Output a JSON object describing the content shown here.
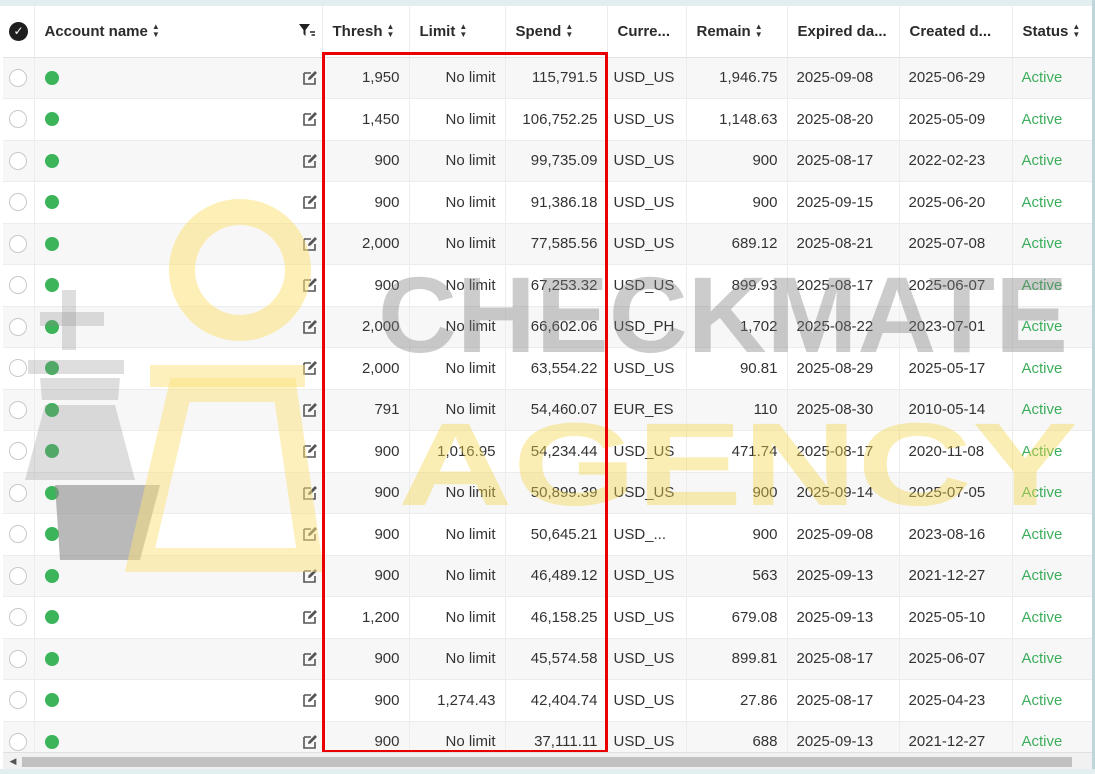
{
  "columns": {
    "account_name": "Account name",
    "thresh": "Thresh",
    "limit": "Limit",
    "spend": "Spend",
    "currency": "Curre...",
    "remain": "Remain",
    "expired": "Expired da...",
    "created": "Created d...",
    "status": "Status"
  },
  "rows": [
    {
      "thresh": "1,950",
      "limit": "No limit",
      "spend": "115,791.5",
      "currency": "USD_US",
      "remain": "1,946.75",
      "expired": "2025-09-08",
      "created": "2025-06-29",
      "status": "Active"
    },
    {
      "thresh": "1,450",
      "limit": "No limit",
      "spend": "106,752.25",
      "currency": "USD_US",
      "remain": "1,148.63",
      "expired": "2025-08-20",
      "created": "2025-05-09",
      "status": "Active"
    },
    {
      "thresh": "900",
      "limit": "No limit",
      "spend": "99,735.09",
      "currency": "USD_US",
      "remain": "900",
      "expired": "2025-08-17",
      "created": "2022-02-23",
      "status": "Active"
    },
    {
      "thresh": "900",
      "limit": "No limit",
      "spend": "91,386.18",
      "currency": "USD_US",
      "remain": "900",
      "expired": "2025-09-15",
      "created": "2025-06-20",
      "status": "Active"
    },
    {
      "thresh": "2,000",
      "limit": "No limit",
      "spend": "77,585.56",
      "currency": "USD_US",
      "remain": "689.12",
      "expired": "2025-08-21",
      "created": "2025-07-08",
      "status": "Active"
    },
    {
      "thresh": "900",
      "limit": "No limit",
      "spend": "67,253.32",
      "currency": "USD_US",
      "remain": "899.93",
      "expired": "2025-08-17",
      "created": "2025-06-07",
      "status": "Active"
    },
    {
      "thresh": "2,000",
      "limit": "No limit",
      "spend": "66,602.06",
      "currency": "USD_PH",
      "remain": "1,702",
      "expired": "2025-08-22",
      "created": "2023-07-01",
      "status": "Active"
    },
    {
      "thresh": "2,000",
      "limit": "No limit",
      "spend": "63,554.22",
      "currency": "USD_US",
      "remain": "90.81",
      "expired": "2025-08-29",
      "created": "2025-05-17",
      "status": "Active"
    },
    {
      "thresh": "791",
      "limit": "No limit",
      "spend": "54,460.07",
      "currency": "EUR_ES",
      "remain": "110",
      "expired": "2025-08-30",
      "created": "2010-05-14",
      "status": "Active"
    },
    {
      "thresh": "900",
      "limit": "1,016.95",
      "spend": "54,234.44",
      "currency": "USD_US",
      "remain": "471.74",
      "expired": "2025-08-17",
      "created": "2020-11-08",
      "status": "Active"
    },
    {
      "thresh": "900",
      "limit": "No limit",
      "spend": "50,899.39",
      "currency": "USD_US",
      "remain": "900",
      "expired": "2025-09-14",
      "created": "2025-07-05",
      "status": "Active"
    },
    {
      "thresh": "900",
      "limit": "No limit",
      "spend": "50,645.21",
      "currency": "USD_...",
      "remain": "900",
      "expired": "2025-09-08",
      "created": "2023-08-16",
      "status": "Active"
    },
    {
      "thresh": "900",
      "limit": "No limit",
      "spend": "46,489.12",
      "currency": "USD_US",
      "remain": "563",
      "expired": "2025-09-13",
      "created": "2021-12-27",
      "status": "Active"
    },
    {
      "thresh": "1,200",
      "limit": "No limit",
      "spend": "46,158.25",
      "currency": "USD_US",
      "remain": "679.08",
      "expired": "2025-09-13",
      "created": "2025-05-10",
      "status": "Active"
    },
    {
      "thresh": "900",
      "limit": "No limit",
      "spend": "45,574.58",
      "currency": "USD_US",
      "remain": "899.81",
      "expired": "2025-08-17",
      "created": "2025-06-07",
      "status": "Active"
    },
    {
      "thresh": "900",
      "limit": "1,274.43",
      "spend": "42,404.74",
      "currency": "USD_US",
      "remain": "27.86",
      "expired": "2025-08-17",
      "created": "2025-04-23",
      "status": "Active"
    },
    {
      "thresh": "900",
      "limit": "No limit",
      "spend": "37,111.11",
      "currency": "USD_US",
      "remain": "688",
      "expired": "2025-09-13",
      "created": "2021-12-27",
      "status": "Active"
    }
  ],
  "watermark": {
    "line1": "CHECKMATE",
    "line2": "AGENCY"
  },
  "colors": {
    "status_active": "#3cae5c",
    "status_dot": "#3cb45a",
    "highlight_border": "#ea0000"
  },
  "icons": {
    "select_all": "check-circle-icon",
    "sort": "sort-arrows-icon",
    "filter": "filter-icon",
    "edit": "edit-icon",
    "row_select": "radio-icon",
    "status": "status-dot-icon"
  }
}
